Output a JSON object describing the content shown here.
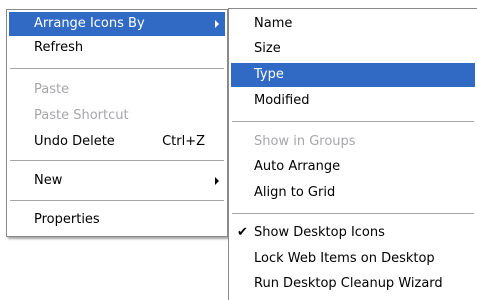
{
  "main_menu": {
    "arrange_icons_by": "Arrange Icons By",
    "refresh": "Refresh",
    "paste": "Paste",
    "paste_shortcut": "Paste Shortcut",
    "undo_delete": "Undo Delete",
    "undo_delete_shortcut": "Ctrl+Z",
    "new": "New",
    "properties": "Properties"
  },
  "submenu": {
    "name": "Name",
    "size": "Size",
    "type": "Type",
    "modified": "Modified",
    "show_in_groups": "Show in Groups",
    "auto_arrange": "Auto Arrange",
    "align_to_grid": "Align to Grid",
    "show_desktop_icons": "Show Desktop Icons",
    "show_desktop_icons_checked": true,
    "lock_web_items": "Lock Web Items on Desktop",
    "cleanup_wizard": "Run Desktop Cleanup Wizard"
  },
  "icons": {
    "submenu_arrow": "chevron-right-icon",
    "check": "checkmark-icon"
  },
  "colors": {
    "highlight": "#316ac5",
    "disabled_text": "#a7a6aa",
    "menu_background": "#ffffff"
  }
}
